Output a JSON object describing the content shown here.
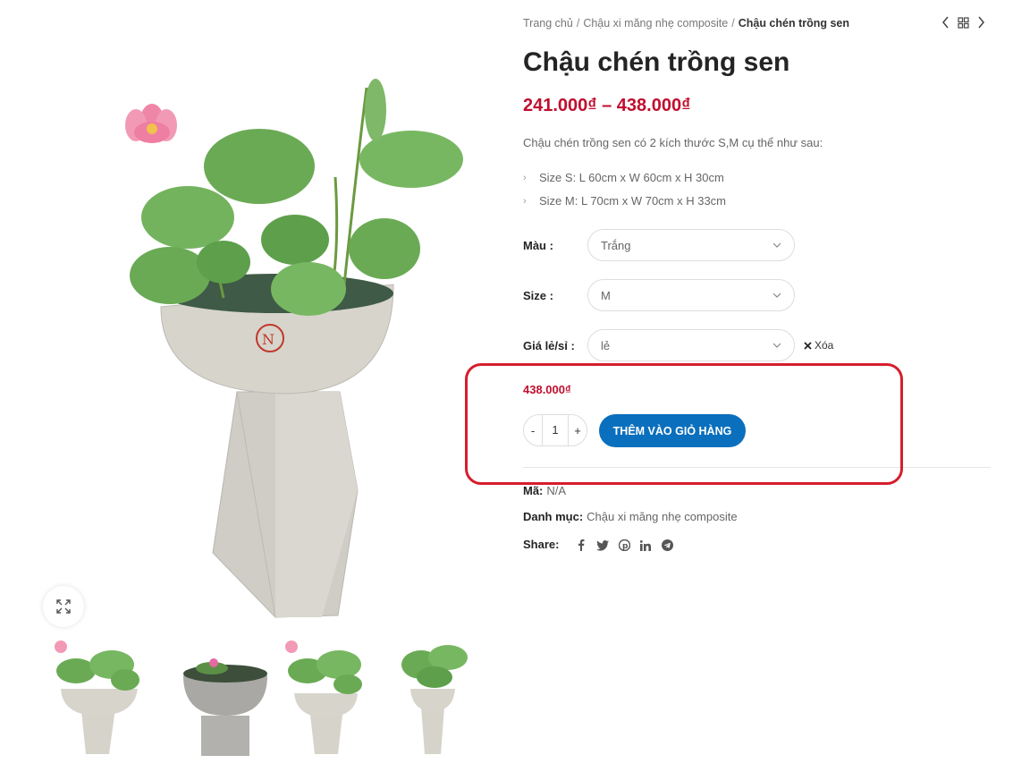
{
  "breadcrumb": {
    "home": "Trang chủ",
    "sep": "/",
    "category": "Chậu xi măng nhẹ composite",
    "current": "Chậu chén trồng sen"
  },
  "product": {
    "title": "Chậu chén trồng sen",
    "price_range": "241.000₫ – 438.000₫",
    "description": "Chậu chén trồng sen có 2 kích thước S,M cụ thể như sau:",
    "sizes": [
      "Size S: L 60cm x  W 60cm x H 30cm",
      "Size M: L 70cm x  W 70cm x H 33cm"
    ]
  },
  "variations": {
    "color": {
      "label": "Màu :",
      "value": "Trắng"
    },
    "size": {
      "label": "Size :",
      "value": "M"
    },
    "price_type": {
      "label": "Giá lẻ/sỉ :",
      "value": "lẻ"
    },
    "clear": "Xóa"
  },
  "selected_price": "438.000₫",
  "quantity": {
    "minus": "-",
    "value": "1",
    "plus": "+"
  },
  "add_to_cart": "THÊM VÀO GIỎ HÀNG",
  "meta": {
    "sku_label": "Mã:",
    "sku_value": "N/A",
    "category_label": "Danh mục:",
    "category_value": "Chậu xi măng nhẹ composite",
    "share_label": "Share:"
  },
  "icons": [
    "chevron-left-icon",
    "grid-icon",
    "chevron-right-icon",
    "expand-icon",
    "facebook-icon",
    "twitter-icon",
    "pinterest-icon",
    "linkedin-icon",
    "telegram-icon"
  ],
  "colors": {
    "price": "#c00e2e",
    "button": "#0a6fbd",
    "highlight": "#d51e2d"
  }
}
